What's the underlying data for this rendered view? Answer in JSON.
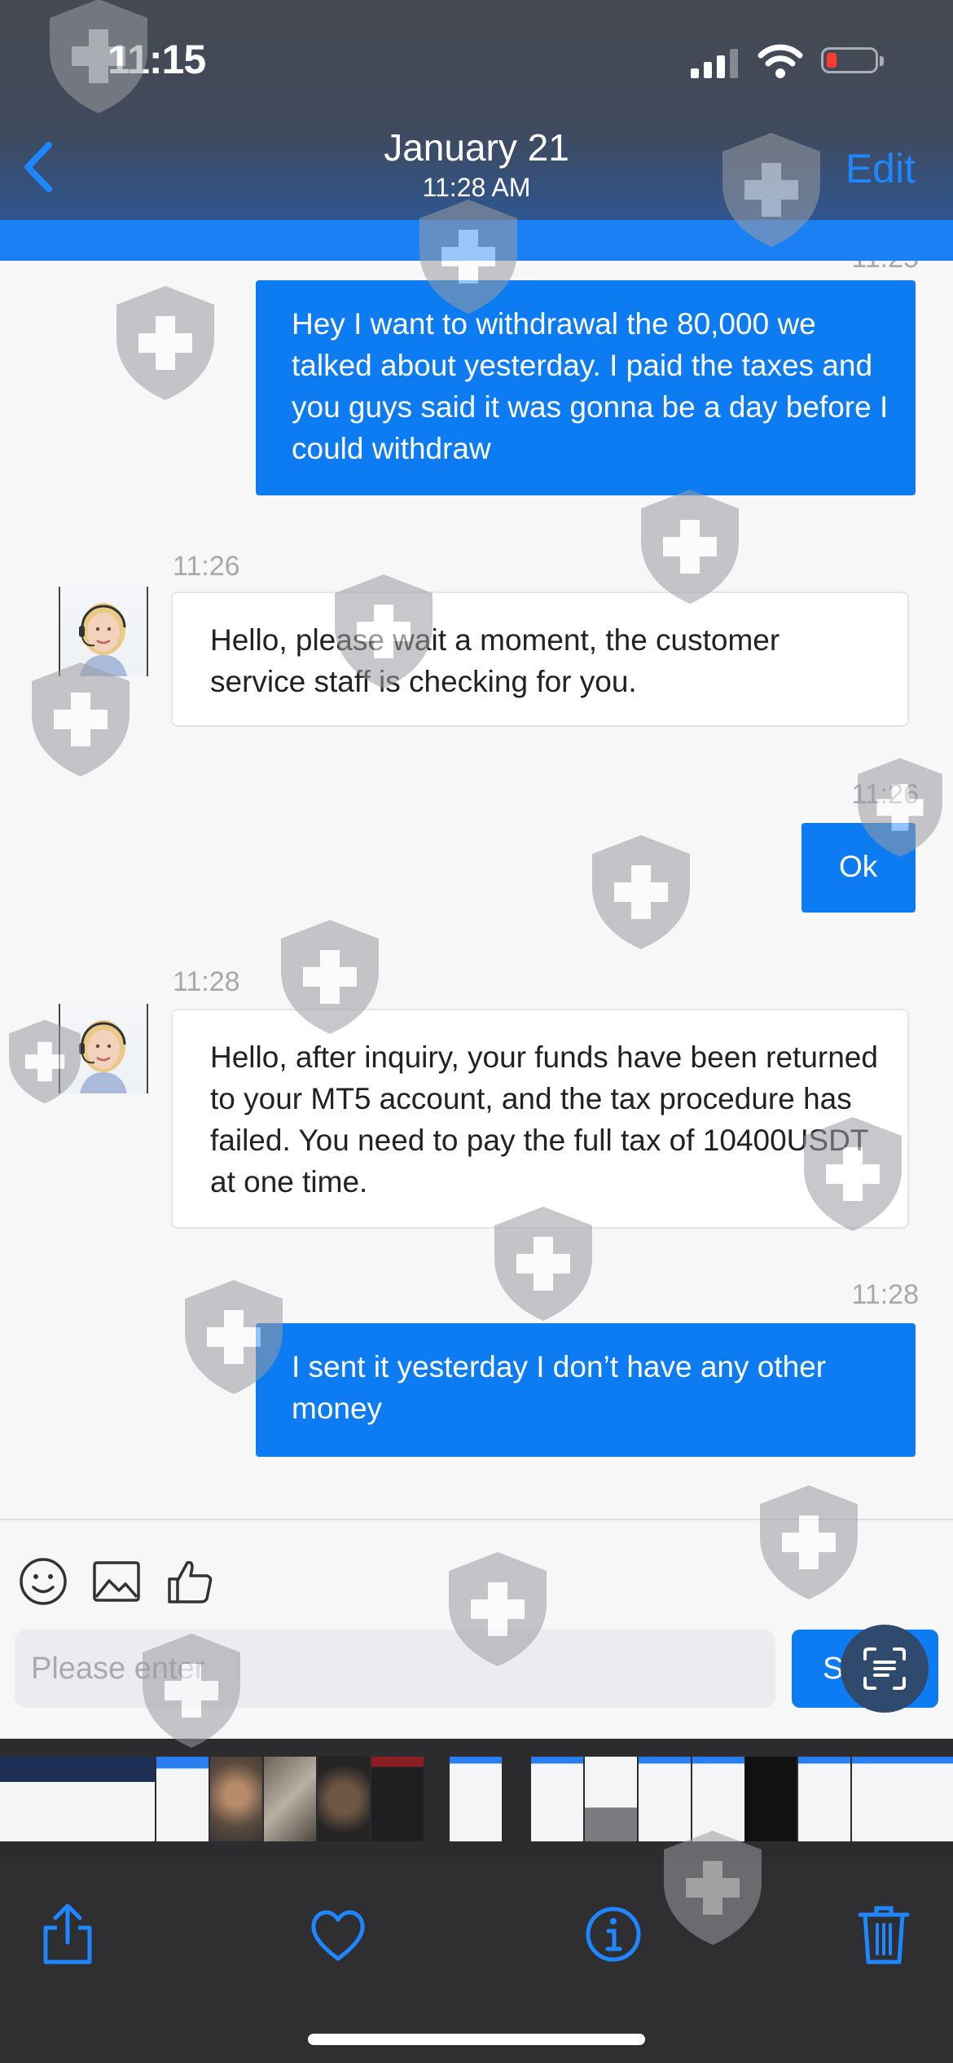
{
  "status_bar": {
    "time": "11:15"
  },
  "nav": {
    "title": "January 21",
    "subtitle": "11:28 AM",
    "edit_label": "Edit"
  },
  "messages": [
    {
      "direction": "out",
      "time": "11:25",
      "text": "Hey I want to withdrawal the 80,000 we talked about yesterday. I paid the taxes and you guys said it was gonna be a day before I could withdraw"
    },
    {
      "direction": "in",
      "time": "11:26",
      "text": "Hello, please wait a moment, the customer service staff is checking for you."
    },
    {
      "direction": "out",
      "time": "11:26",
      "text": "Ok"
    },
    {
      "direction": "in",
      "time": "11:28",
      "text": "Hello, after inquiry, your funds have been returned to your MT5 account, and the tax procedure has failed. You need to pay the full tax of 10400USDT at one time."
    },
    {
      "direction": "out",
      "time": "11:28",
      "text": "I sent it yesterday I don’t have any other money"
    }
  ],
  "composer": {
    "placeholder": "Please enter",
    "send_label": "Send"
  },
  "toolbar_icons": [
    "emoji-icon",
    "image-icon",
    "thumbs-up-icon"
  ],
  "bottom_bar_icons": [
    "share-icon",
    "heart-icon",
    "info-icon",
    "trash-icon"
  ],
  "colors": {
    "accent": "#0d7cf2",
    "link": "#1e86ff",
    "battery_low": "#ff3b30"
  }
}
